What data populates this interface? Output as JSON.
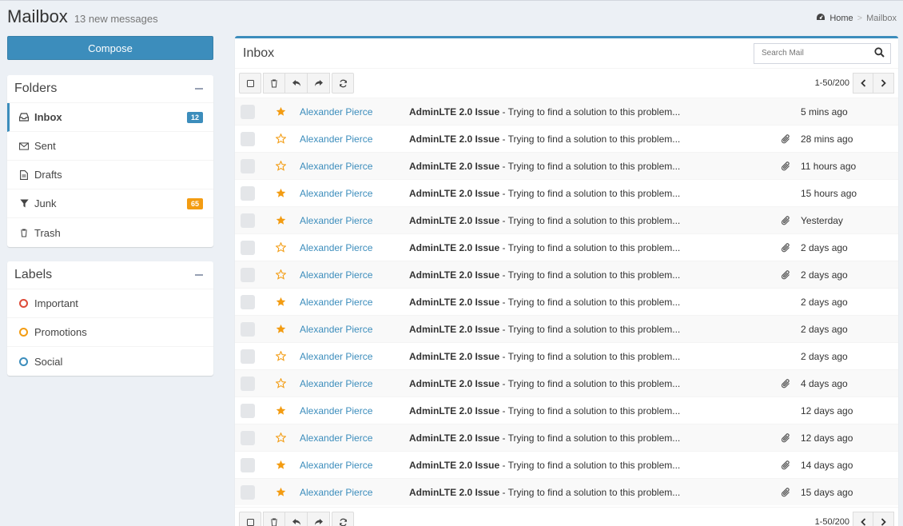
{
  "header": {
    "title": "Mailbox",
    "subtitle": "13 new messages"
  },
  "breadcrumb": {
    "home": "Home",
    "current": "Mailbox"
  },
  "compose_label": "Compose",
  "folders": {
    "title": "Folders",
    "items": [
      {
        "label": "Inbox",
        "icon": "inbox-icon",
        "badge": "12",
        "badge_color": "#3c8dbc"
      },
      {
        "label": "Sent",
        "icon": "envelope-icon"
      },
      {
        "label": "Drafts",
        "icon": "file-icon"
      },
      {
        "label": "Junk",
        "icon": "filter-icon",
        "badge": "65",
        "badge_color": "#f39c12"
      },
      {
        "label": "Trash",
        "icon": "trash-icon"
      }
    ]
  },
  "labels": {
    "title": "Labels",
    "items": [
      {
        "label": "Important",
        "color": "#dd4b39"
      },
      {
        "label": "Promotions",
        "color": "#f39c12"
      },
      {
        "label": "Social",
        "color": "#3c8dbc"
      }
    ]
  },
  "inbox": {
    "title": "Inbox",
    "search_placeholder": "Search Mail",
    "pager_text": "1-50/200",
    "messages": [
      {
        "starred": true,
        "sender": "Alexander Pierce",
        "subject_bold": "AdminLTE 2.0 Issue",
        "subject_rest": " - Trying to find a solution to this problem...",
        "attachment": false,
        "date": "5 mins ago"
      },
      {
        "starred": false,
        "sender": "Alexander Pierce",
        "subject_bold": "AdminLTE 2.0 Issue",
        "subject_rest": " - Trying to find a solution to this problem...",
        "attachment": true,
        "date": "28 mins ago"
      },
      {
        "starred": false,
        "sender": "Alexander Pierce",
        "subject_bold": "AdminLTE 2.0 Issue",
        "subject_rest": " - Trying to find a solution to this problem...",
        "attachment": true,
        "date": "11 hours ago"
      },
      {
        "starred": true,
        "sender": "Alexander Pierce",
        "subject_bold": "AdminLTE 2.0 Issue",
        "subject_rest": " - Trying to find a solution to this problem...",
        "attachment": false,
        "date": "15 hours ago"
      },
      {
        "starred": true,
        "sender": "Alexander Pierce",
        "subject_bold": "AdminLTE 2.0 Issue",
        "subject_rest": " - Trying to find a solution to this problem...",
        "attachment": true,
        "date": "Yesterday"
      },
      {
        "starred": false,
        "sender": "Alexander Pierce",
        "subject_bold": "AdminLTE 2.0 Issue",
        "subject_rest": " - Trying to find a solution to this problem...",
        "attachment": true,
        "date": "2 days ago"
      },
      {
        "starred": false,
        "sender": "Alexander Pierce",
        "subject_bold": "AdminLTE 2.0 Issue",
        "subject_rest": " - Trying to find a solution to this problem...",
        "attachment": true,
        "date": "2 days ago"
      },
      {
        "starred": true,
        "sender": "Alexander Pierce",
        "subject_bold": "AdminLTE 2.0 Issue",
        "subject_rest": " - Trying to find a solution to this problem...",
        "attachment": false,
        "date": "2 days ago"
      },
      {
        "starred": true,
        "sender": "Alexander Pierce",
        "subject_bold": "AdminLTE 2.0 Issue",
        "subject_rest": " - Trying to find a solution to this problem...",
        "attachment": false,
        "date": "2 days ago"
      },
      {
        "starred": false,
        "sender": "Alexander Pierce",
        "subject_bold": "AdminLTE 2.0 Issue",
        "subject_rest": " - Trying to find a solution to this problem...",
        "attachment": false,
        "date": "2 days ago"
      },
      {
        "starred": false,
        "sender": "Alexander Pierce",
        "subject_bold": "AdminLTE 2.0 Issue",
        "subject_rest": " - Trying to find a solution to this problem...",
        "attachment": true,
        "date": "4 days ago"
      },
      {
        "starred": true,
        "sender": "Alexander Pierce",
        "subject_bold": "AdminLTE 2.0 Issue",
        "subject_rest": " - Trying to find a solution to this problem...",
        "attachment": false,
        "date": "12 days ago"
      },
      {
        "starred": false,
        "sender": "Alexander Pierce",
        "subject_bold": "AdminLTE 2.0 Issue",
        "subject_rest": " - Trying to find a solution to this problem...",
        "attachment": true,
        "date": "12 days ago"
      },
      {
        "starred": true,
        "sender": "Alexander Pierce",
        "subject_bold": "AdminLTE 2.0 Issue",
        "subject_rest": " - Trying to find a solution to this problem...",
        "attachment": true,
        "date": "14 days ago"
      },
      {
        "starred": true,
        "sender": "Alexander Pierce",
        "subject_bold": "AdminLTE 2.0 Issue",
        "subject_rest": " - Trying to find a solution to this problem...",
        "attachment": true,
        "date": "15 days ago"
      }
    ]
  },
  "colors": {
    "accent": "#3c8dbc",
    "star": "#f39c12",
    "background": "#ecf0f5"
  }
}
